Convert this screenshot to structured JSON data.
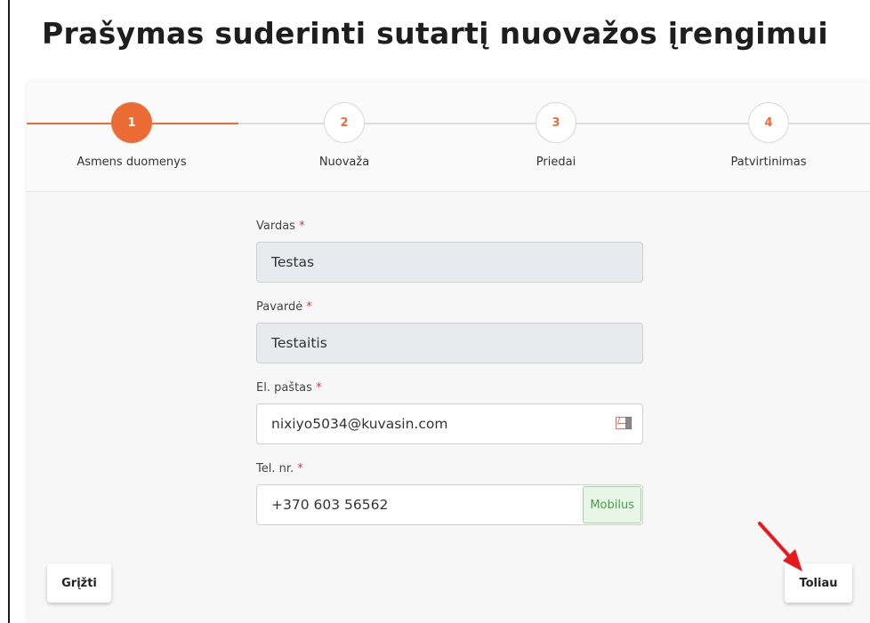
{
  "page": {
    "title": "Prašymas suderinti sutartį nuovažos įrengimui"
  },
  "stepper": {
    "steps": [
      {
        "number": "1",
        "label": "Asmens duomenys"
      },
      {
        "number": "2",
        "label": "Nuovaža"
      },
      {
        "number": "3",
        "label": "Priedai"
      },
      {
        "number": "4",
        "label": "Patvirtinimas"
      }
    ]
  },
  "form": {
    "required_marker": "*",
    "first_name": {
      "label": "Vardas",
      "value": "Testas"
    },
    "last_name": {
      "label": "Pavardė",
      "value": "Testaitis"
    },
    "email": {
      "label": "El. paštas",
      "value": "nixiyo5034@kuvasin.com"
    },
    "phone": {
      "label": "Tel. nr.",
      "value": "+370 603 56562",
      "badge": "Mobilus"
    }
  },
  "buttons": {
    "back": "Grįžti",
    "next": "Toliau"
  },
  "colors": {
    "accent": "#ec6c36",
    "arrow": "#e8191c",
    "mobile_badge": "#45a045"
  }
}
